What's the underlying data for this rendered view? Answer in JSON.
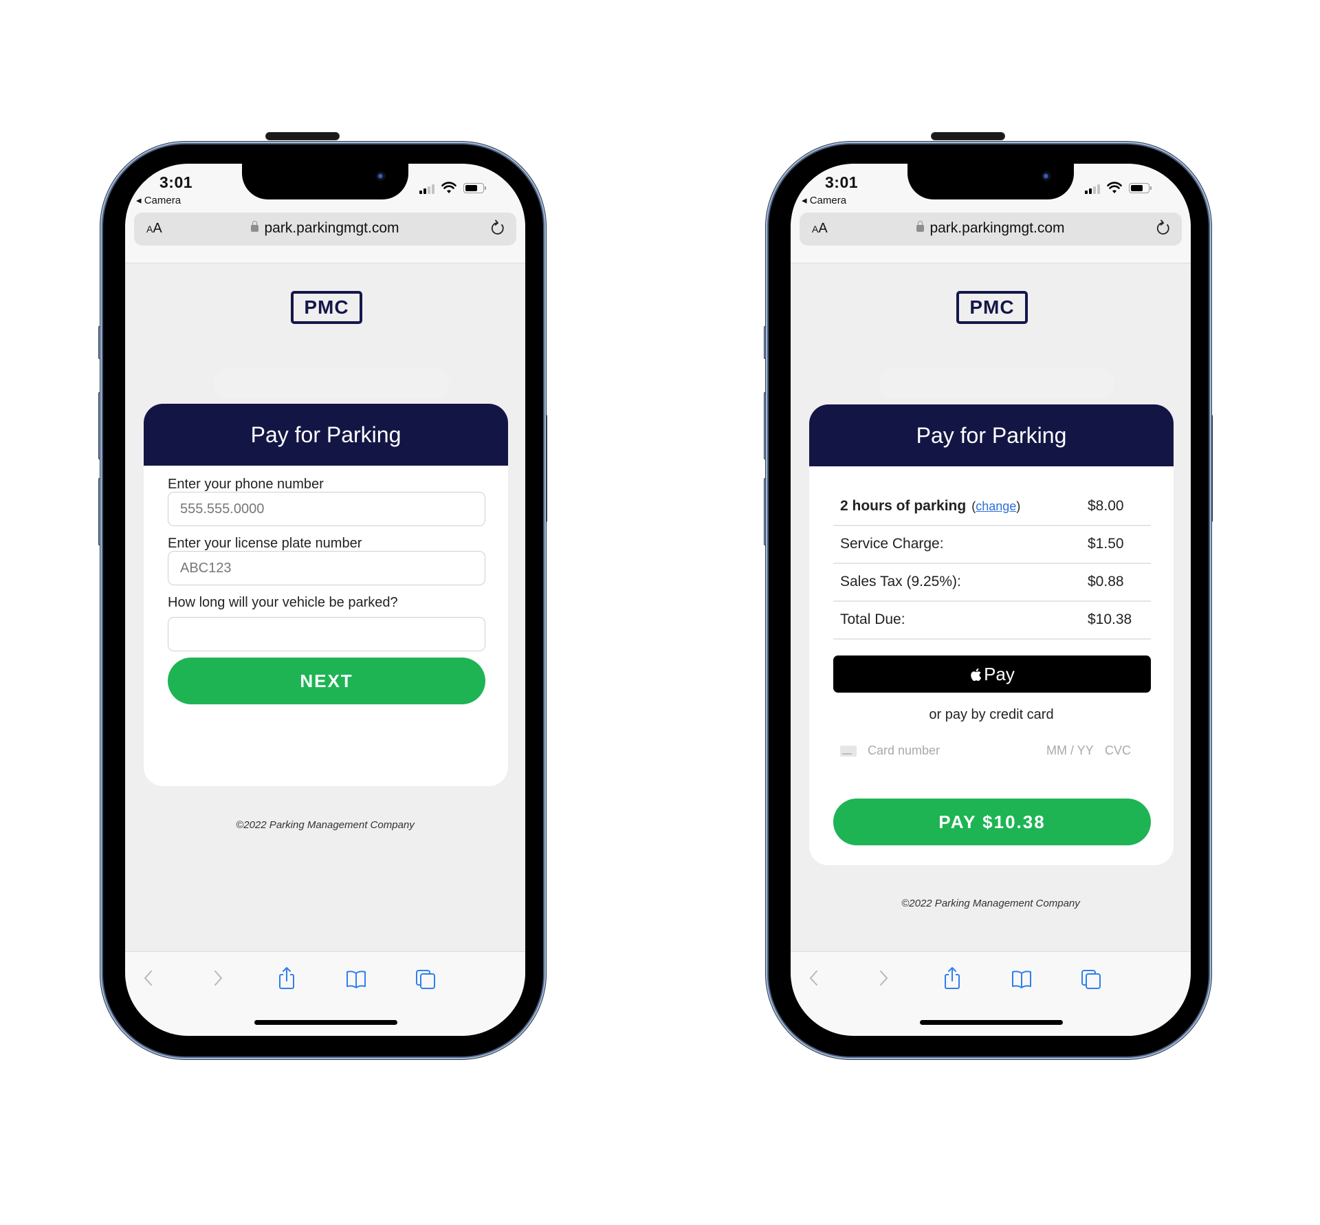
{
  "phones": [
    {
      "status": {
        "time": "3:01",
        "back_app": "◂ Camera",
        "signal_bars_filled": 2,
        "signal_bars_total": 4,
        "battery_level": 0.65
      },
      "browser": {
        "text_size_label_small": "A",
        "text_size_label_large": "A",
        "url": "park.parkingmgt.com"
      },
      "logo": "PMC",
      "card_title": "Pay for Parking",
      "form": {
        "phone_label": "Enter your phone number",
        "phone_placeholder": "555.555.0000",
        "plate_label": "Enter your license plate number",
        "plate_placeholder": "ABC123",
        "duration_label": "How long will your vehicle be parked?",
        "duration_value": "",
        "next_label": "NEXT"
      },
      "footer": "©2022 Parking Management Company"
    },
    {
      "status": {
        "time": "3:01",
        "back_app": "◂ Camera",
        "signal_bars_filled": 2,
        "signal_bars_total": 4,
        "battery_level": 0.65
      },
      "browser": {
        "text_size_label_small": "A",
        "text_size_label_large": "A",
        "url": "park.parkingmgt.com"
      },
      "logo": "PMC",
      "card_title": "Pay for Parking",
      "summary": {
        "parking_label": "2 hours of parking",
        "change_open": "(",
        "change_link": "change",
        "change_close": ")",
        "parking_amount": "$8.00",
        "service_label": "Service Charge:",
        "service_amount": "$1.50",
        "tax_label": "Sales Tax (9.25%):",
        "tax_amount": "$0.88",
        "total_label": "Total Due:",
        "total_amount": "$10.38"
      },
      "apple_pay_label": "Pay",
      "or_pay_text": "or pay by credit card",
      "card_input": {
        "number_placeholder": "Card number",
        "expiry_placeholder": "MM / YY",
        "cvc_placeholder": "CVC"
      },
      "pay_button_label": "PAY $10.38",
      "footer": "©2022 Parking Management Company"
    }
  ],
  "colors": {
    "brand_navy": "#131645",
    "action_green": "#1eb454",
    "link_blue": "#2a6fdb",
    "toolbar_blue": "#2f7ef0"
  }
}
